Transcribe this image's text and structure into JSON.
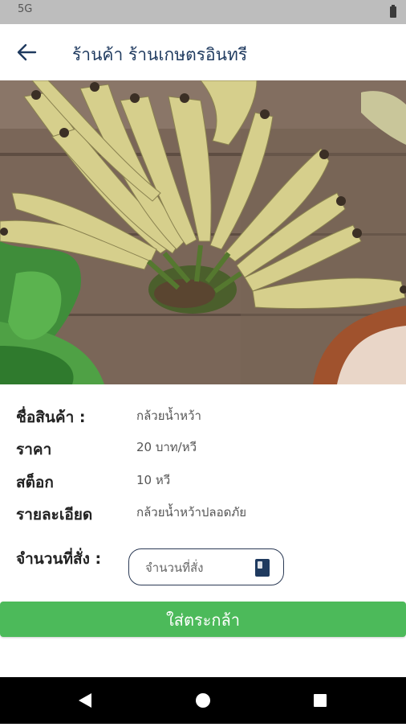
{
  "status_bar": {
    "time": "5G"
  },
  "header": {
    "back_icon": "arrow-left-icon",
    "title": "ร้านค้า ร้านเกษตรอินทรี"
  },
  "product": {
    "image_subject": "bunch of bananas",
    "fields": [
      {
        "label": "ชื่อสินค้า :",
        "value": "กล้วยน้ำหว้า"
      },
      {
        "label": "ราคา",
        "value": "20 บาท/หวี"
      },
      {
        "label": "สต็อก",
        "value": "10 หวี"
      },
      {
        "label": "รายละเอียด",
        "value": "กล้วยน้ำหว้าปลอดภัย"
      }
    ]
  },
  "order": {
    "quantity_label": "จำนวนที่สั่ง :",
    "quantity_placeholder": "จำนวนที่สั่ง",
    "quantity_icon": "book-icon"
  },
  "actions": {
    "add_to_cart": "ใส่ตระกล้า"
  },
  "colors": {
    "title": "#1f3a5f",
    "button": "#4cba5a",
    "status_bar": "#bdbdbd",
    "nav_bar": "#000000"
  },
  "nav": {
    "icons": [
      "back-triangle-icon",
      "home-circle-icon",
      "recents-square-icon"
    ]
  }
}
